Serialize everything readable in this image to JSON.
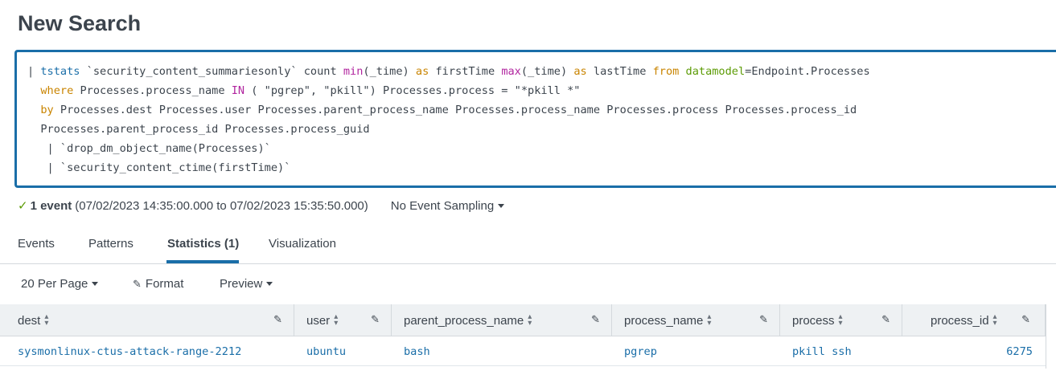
{
  "page": {
    "title": "New Search"
  },
  "search": {
    "line1": {
      "pipe": "| ",
      "cmd": "tstats",
      "macro": " `security_content_summariesonly` count ",
      "fn1": "min",
      "arg1": "(_time) ",
      "as1": "as",
      "field1": " firstTime ",
      "fn2": "max",
      "arg2": "(_time) ",
      "as2": "as",
      "field2": " lastTime ",
      "from": "from",
      "dm": " datamodel",
      "dmval": "=Endpoint.Processes"
    },
    "line2": {
      "where": "where",
      "rest1": " Processes.process_name ",
      "in": "IN",
      "rest2": " ( \"pgrep\", \"pkill\") Processes.process = \"*pkill *\""
    },
    "line3": {
      "by": "by",
      "rest": " Processes.dest Processes.user Processes.parent_process_name Processes.process_name Processes.process Processes.process_id"
    },
    "line4": "Processes.parent_process_id Processes.process_guid",
    "line5": " | `drop_dm_object_name(Processes)`",
    "line6": " | `security_content_ctime(firstTime)`"
  },
  "status": {
    "check_icon": "checkmark-icon",
    "count": "1 event",
    "range": "(07/02/2023 14:35:00.000 to 07/02/2023 15:35:50.000)",
    "sampling": "No Event Sampling"
  },
  "tabs": [
    {
      "label": "Events"
    },
    {
      "label": "Patterns"
    },
    {
      "label": "Statistics (1)"
    },
    {
      "label": "Visualization"
    }
  ],
  "toolbar": {
    "per_page": "20 Per Page",
    "format": "Format",
    "preview": "Preview"
  },
  "table": {
    "headers": [
      "dest",
      "user",
      "parent_process_name",
      "process_name",
      "process",
      "process_id"
    ],
    "rows": [
      [
        "sysmonlinux-ctus-attack-range-2212",
        "ubuntu",
        "bash",
        "pgrep",
        "pkill ssh",
        "6275"
      ]
    ]
  },
  "colors": {
    "accent": "#1a6ea8",
    "success": "#5c9b05",
    "keyword_orange": "#c98400",
    "keyword_pink": "#b1259f"
  }
}
